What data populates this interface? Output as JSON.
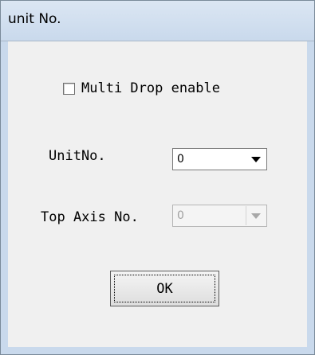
{
  "window": {
    "title": "unit No."
  },
  "multi_drop": {
    "label": "Multi Drop enable",
    "checked": false
  },
  "unit_no": {
    "label": "UnitNo.",
    "value": "0",
    "enabled": true
  },
  "top_axis_no": {
    "label": "Top Axis No.",
    "value": "0",
    "enabled": false
  },
  "ok_button": {
    "label": "OK"
  },
  "icons": {
    "checkbox": "checkbox-unchecked-icon",
    "dropdown": "chevron-down-icon"
  }
}
